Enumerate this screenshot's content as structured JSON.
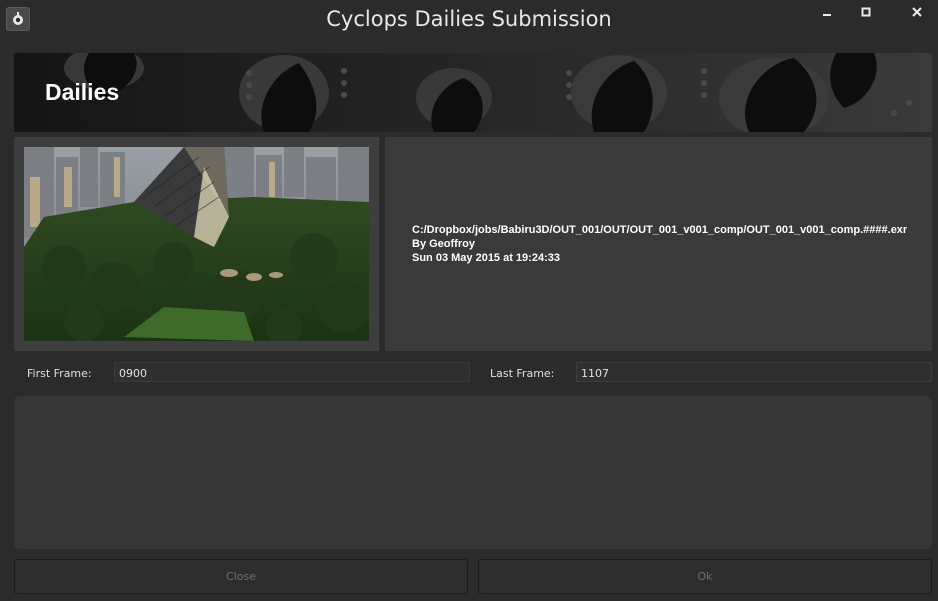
{
  "window": {
    "title": "Cyclops Dailies Submission",
    "controls": {
      "minimize": "▁",
      "maximize": "□",
      "close": "✕"
    }
  },
  "banner": {
    "title": "Dailies"
  },
  "thumbnail": {
    "icon": "aerial-city-park-thumbnail"
  },
  "info": {
    "path": "C:/Dropbox/jobs/Babiru3D/OUT_001/OUT/OUT_001_v001_comp/OUT_001_v001_comp.####.exr",
    "author": "By Geoffroy",
    "date": "Sun 03 May 2015 at 19:24:33"
  },
  "frames": {
    "first_label": "First Frame:",
    "first_value": "0900",
    "last_label": "Last Frame:",
    "last_value": "1107"
  },
  "notes": {
    "value": ""
  },
  "buttons": {
    "close": "Close",
    "ok": "Ok"
  }
}
